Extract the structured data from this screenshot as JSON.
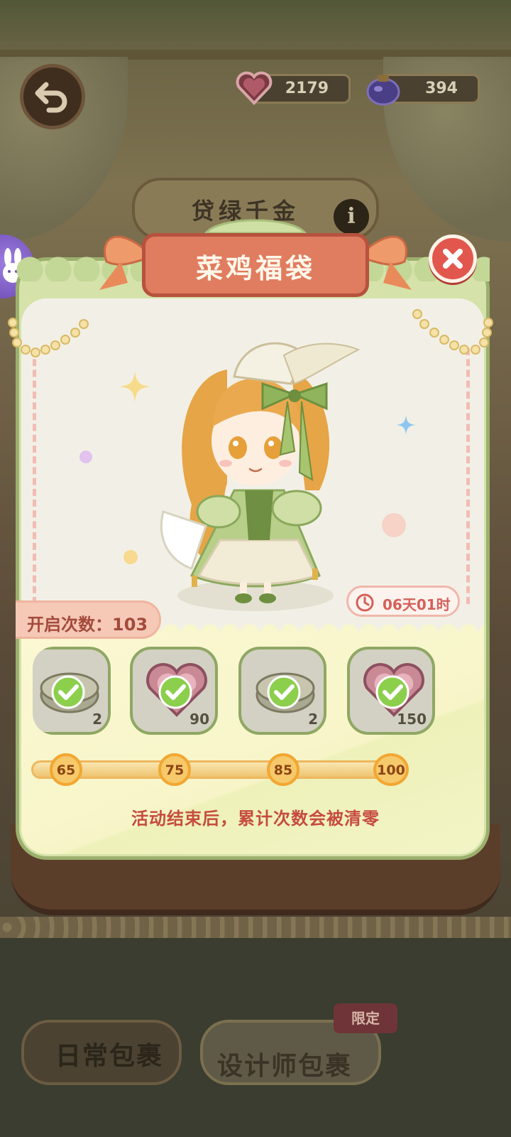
{
  "currency": {
    "hearts": "2179",
    "potion": "394"
  },
  "background": {
    "banner_text": "贷绿千金"
  },
  "modal": {
    "title": "菜鸡福袋",
    "timer": "06天01时",
    "open_count_label": "开启次数：103",
    "rewards": [
      {
        "qty": "2",
        "item_icon": "treasure-box-icon",
        "claimed": true
      },
      {
        "qty": "90",
        "item_icon": "heart-gem-icon",
        "claimed": true
      },
      {
        "qty": "2",
        "item_icon": "treasure-box-icon",
        "claimed": true
      },
      {
        "qty": "150",
        "item_icon": "heart-gem-icon",
        "claimed": true
      }
    ],
    "milestones": [
      "65",
      "75",
      "85",
      "100"
    ],
    "progress_fraction": 1.0,
    "notice": "活动结束后，累计次数会被清零"
  },
  "tabs": {
    "daily": "日常包裹",
    "designer": "设计师包裹",
    "limited_badge": "限定"
  },
  "colors": {
    "accent_title": "#e07c5f",
    "close_red": "#e2574d",
    "modal_green": "#d5e2a9",
    "notice_red": "#c64b3f",
    "milestone_gold": "#f6c96a"
  }
}
